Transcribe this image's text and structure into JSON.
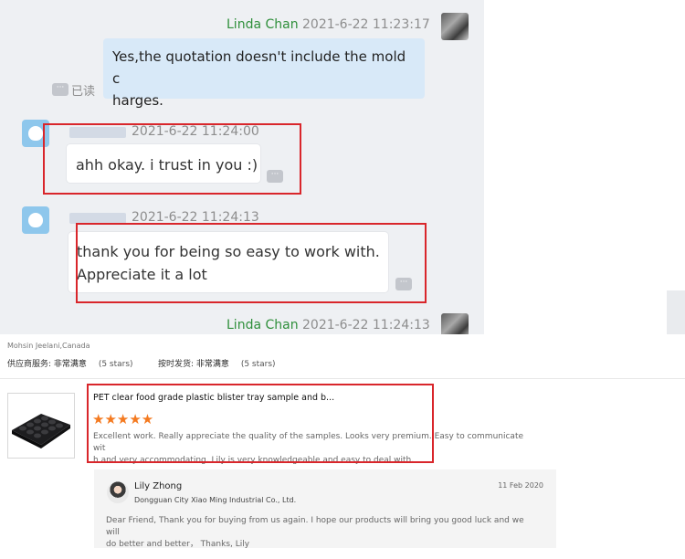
{
  "chat": {
    "messages": [
      {
        "sender": "Linda Chan",
        "timestamp": "2021-6-22 11:23:17",
        "text_line1": "Yes,the quotation doesn't include the mold c",
        "text_line2": "harges.",
        "read_status": "已读"
      },
      {
        "timestamp": "2021-6-22 11:24:00",
        "text": "ahh okay. i trust in you :)"
      },
      {
        "timestamp": "2021-6-22 11:24:13",
        "text_line1": "thank you for being so easy to work with.",
        "text_line2": "Appreciate it a lot"
      },
      {
        "sender": "Linda Chan",
        "timestamp": "2021-6-22 11:24:13"
      }
    ]
  },
  "review": {
    "buyer": "Mohsin Jeelani,Canada",
    "supplier_service_label": "供应商服务:",
    "supplier_service_value": "非常满意",
    "supplier_service_stars": "(5 stars)",
    "delivery_label": "按时发货:",
    "delivery_value": "非常满意",
    "delivery_stars": "(5 stars)",
    "product_title": "PET clear food grade plastic blister tray sample and b...",
    "rating_stars": "★★★★★",
    "rating": 5,
    "text_line1": "Excellent work. Really appreciate the quality of the samples. Looks very premium. Easy to communicate wit",
    "text_line2": "h and very accommodating. Lily is very knowledgeable and easy to deal with.",
    "reply": {
      "name": "Lily Zhong",
      "company": "Dongguan City Xiao Ming Industrial Co., Ltd.",
      "date": "11 Feb 2020",
      "text_line1": "Dear Friend, Thank you for buying from us again. I hope our products will bring you good luck and we will",
      "text_line2": "do better and better， Thanks, Lily"
    }
  },
  "colors": {
    "highlight_box": "#d9262b",
    "sender_name": "#2f8f3b",
    "star": "#f47a20",
    "outgoing_bubble": "#d8e9f8"
  }
}
